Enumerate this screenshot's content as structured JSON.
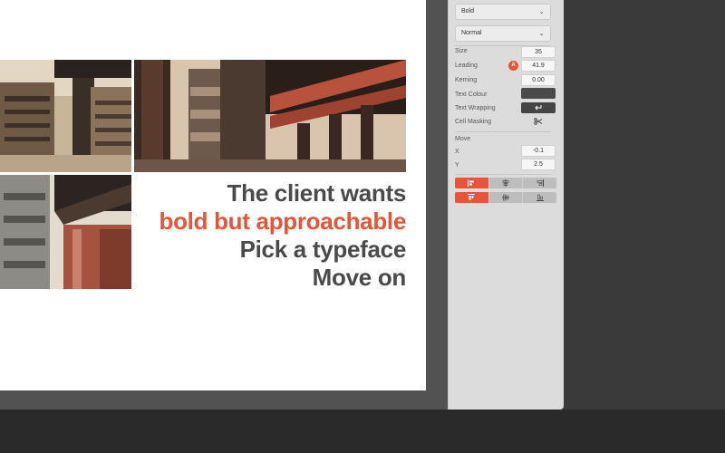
{
  "canvas": {
    "headline": {
      "line1": "The client wants",
      "line2": "bold but approachable",
      "line3": "Pick a typeface",
      "line4": "Move on"
    },
    "accent_color": "#e5553a",
    "text_color": "#4a4a4a"
  },
  "panel": {
    "font_weight": "Bold",
    "font_style": "Normal",
    "size_label": "Size",
    "size_value": "35",
    "leading_label": "Leading",
    "leading_badge": "A",
    "leading_value": "41.9",
    "kerning_label": "Kerning",
    "kerning_value": "0.00",
    "text_colour_label": "Text Colour",
    "text_colour_value": "#4a4a4a",
    "text_wrapping_label": "Text Wrapping",
    "cell_masking_label": "Cell Masking",
    "move_label": "Move",
    "x_label": "X",
    "x_value": "-0.1",
    "y_label": "Y",
    "y_value": "2.5"
  },
  "icons": {
    "dropdown_chevron": "chevron-down-icon",
    "text_wrapping": "return-arrow-icon",
    "cell_masking": "scissors-icon",
    "align_left": "align-left-icon",
    "align_center": "align-center-icon",
    "align_right": "align-right-icon",
    "align_top": "align-top-icon",
    "align_middle": "align-middle-icon",
    "align_bottom": "align-bottom-icon"
  }
}
